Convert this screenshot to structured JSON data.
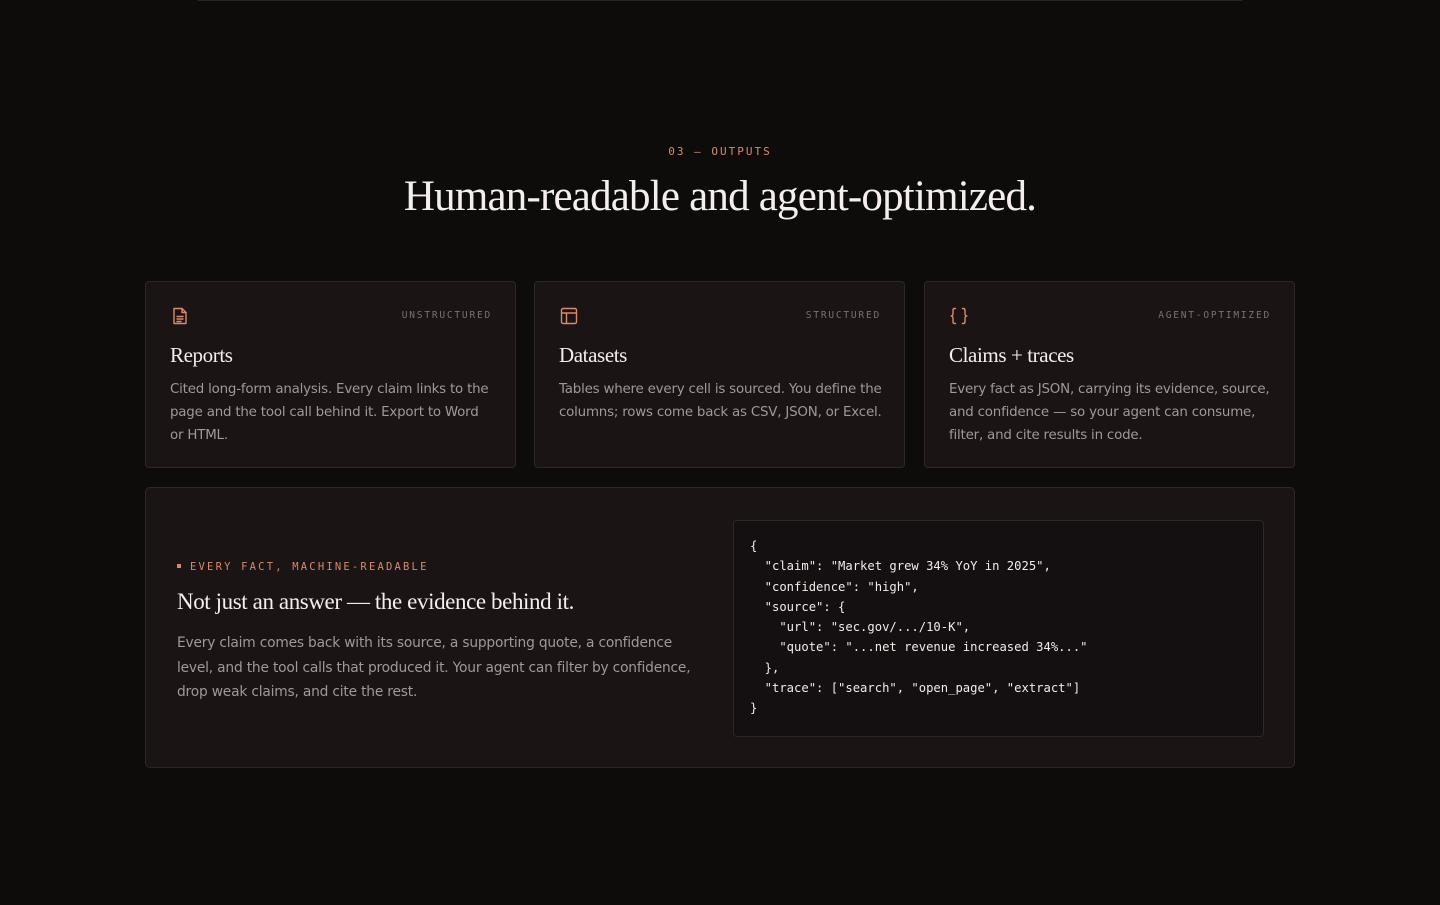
{
  "section": {
    "eyebrow": "03 — OUTPUTS",
    "headline": "Human-readable and agent-optimized."
  },
  "cards": [
    {
      "icon": "document-icon",
      "tag": "UNSTRUCTURED",
      "title": "Reports",
      "description": "Cited long-form analysis. Every claim links to the page and the tool call behind it. Export to Word or HTML."
    },
    {
      "icon": "table-icon",
      "tag": "STRUCTURED",
      "title": "Datasets",
      "description": "Tables where every cell is sourced. You define the columns; rows come back as CSV, JSON, or Excel."
    },
    {
      "icon": "braces-icon",
      "tag": "AGENT-OPTIMIZED",
      "title": "Claims + traces",
      "description": "Every fact as JSON, carrying its evidence, source, and confidence — so your agent can consume, filter, and cite results in code."
    }
  ],
  "feature": {
    "eyebrow": "EVERY FACT, MACHINE-READABLE",
    "title": "Not just an answer — the evidence behind it.",
    "description": "Every claim comes back with its source, a supporting quote, a confidence level, and the tool calls that produced it. Your agent can filter by confidence, drop weak claims, and cite the rest.",
    "code_lines": [
      "{",
      "  \"claim\": \"Market grew 34% YoY in 2025\",",
      "  \"confidence\": \"high\",",
      "  \"source\": {",
      "    \"url\": \"sec.gov/.../10-K\",",
      "    \"quote\": \"...net revenue increased 34%...\"",
      "  },",
      "  \"trace\": [\"search\", \"open_page\", \"extract\"]",
      "}"
    ]
  },
  "colors": {
    "background": "#0e0b0b",
    "card": "#1a1415",
    "accent": "#d88a6c",
    "border": "#2e2728"
  }
}
